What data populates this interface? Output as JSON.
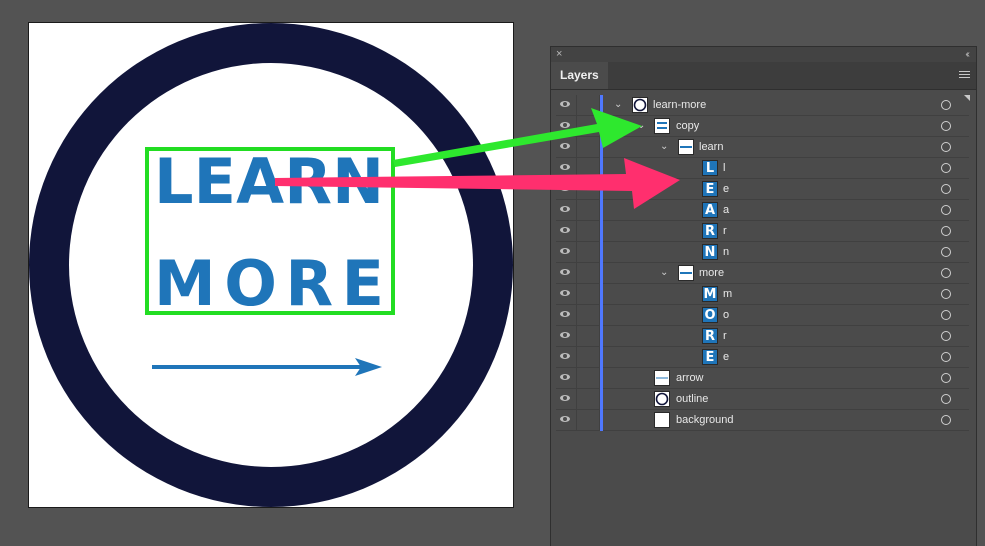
{
  "artboard": {
    "line1": [
      "L",
      "E",
      "A",
      "R",
      "N"
    ],
    "line2": [
      "M",
      "O",
      "R",
      "E"
    ],
    "colors": {
      "ring": "#11153a",
      "text": "#1f75b9",
      "highlight_box": "#22dd22",
      "green_arrow": "#2ee82e",
      "pink_arrow": "#ff2f6e"
    }
  },
  "panel": {
    "close_glyph": "×",
    "collapse_glyph": "‹‹",
    "tab_label": "Layers",
    "menu_icon": "hamburger-icon",
    "layer_color": "#4f78ff",
    "rows": [
      {
        "name": "learn-more",
        "depth": 0,
        "twirl": true,
        "thumb": "circle",
        "visible": true
      },
      {
        "name": "copy",
        "depth": 1,
        "twirl": true,
        "thumb": "text-block",
        "visible": true
      },
      {
        "name": "learn",
        "depth": 2,
        "twirl": true,
        "thumb": "text-strip",
        "visible": true
      },
      {
        "name": "l",
        "depth": 3,
        "twirl": false,
        "thumb": "letter",
        "letter": "L",
        "visible": true
      },
      {
        "name": "e",
        "depth": 3,
        "twirl": false,
        "thumb": "letter",
        "letter": "E",
        "visible": true
      },
      {
        "name": "a",
        "depth": 3,
        "twirl": false,
        "thumb": "letter",
        "letter": "A",
        "visible": true
      },
      {
        "name": "r",
        "depth": 3,
        "twirl": false,
        "thumb": "letter",
        "letter": "R",
        "visible": true
      },
      {
        "name": "n",
        "depth": 3,
        "twirl": false,
        "thumb": "letter",
        "letter": "N",
        "visible": true
      },
      {
        "name": "more",
        "depth": 2,
        "twirl": true,
        "thumb": "text-strip",
        "visible": true
      },
      {
        "name": "m",
        "depth": 3,
        "twirl": false,
        "thumb": "letter",
        "letter": "M",
        "visible": true
      },
      {
        "name": "o",
        "depth": 3,
        "twirl": false,
        "thumb": "letter",
        "letter": "O",
        "visible": true
      },
      {
        "name": "r",
        "depth": 3,
        "twirl": false,
        "thumb": "letter",
        "letter": "R",
        "visible": true
      },
      {
        "name": "e",
        "depth": 3,
        "twirl": false,
        "thumb": "letter",
        "letter": "E",
        "visible": true
      },
      {
        "name": "arrow",
        "depth": 1,
        "twirl": false,
        "thumb": "line",
        "visible": true
      },
      {
        "name": "outline",
        "depth": 1,
        "twirl": false,
        "thumb": "circle",
        "visible": true
      },
      {
        "name": "background",
        "depth": 1,
        "twirl": false,
        "thumb": "blank",
        "visible": true
      }
    ]
  }
}
